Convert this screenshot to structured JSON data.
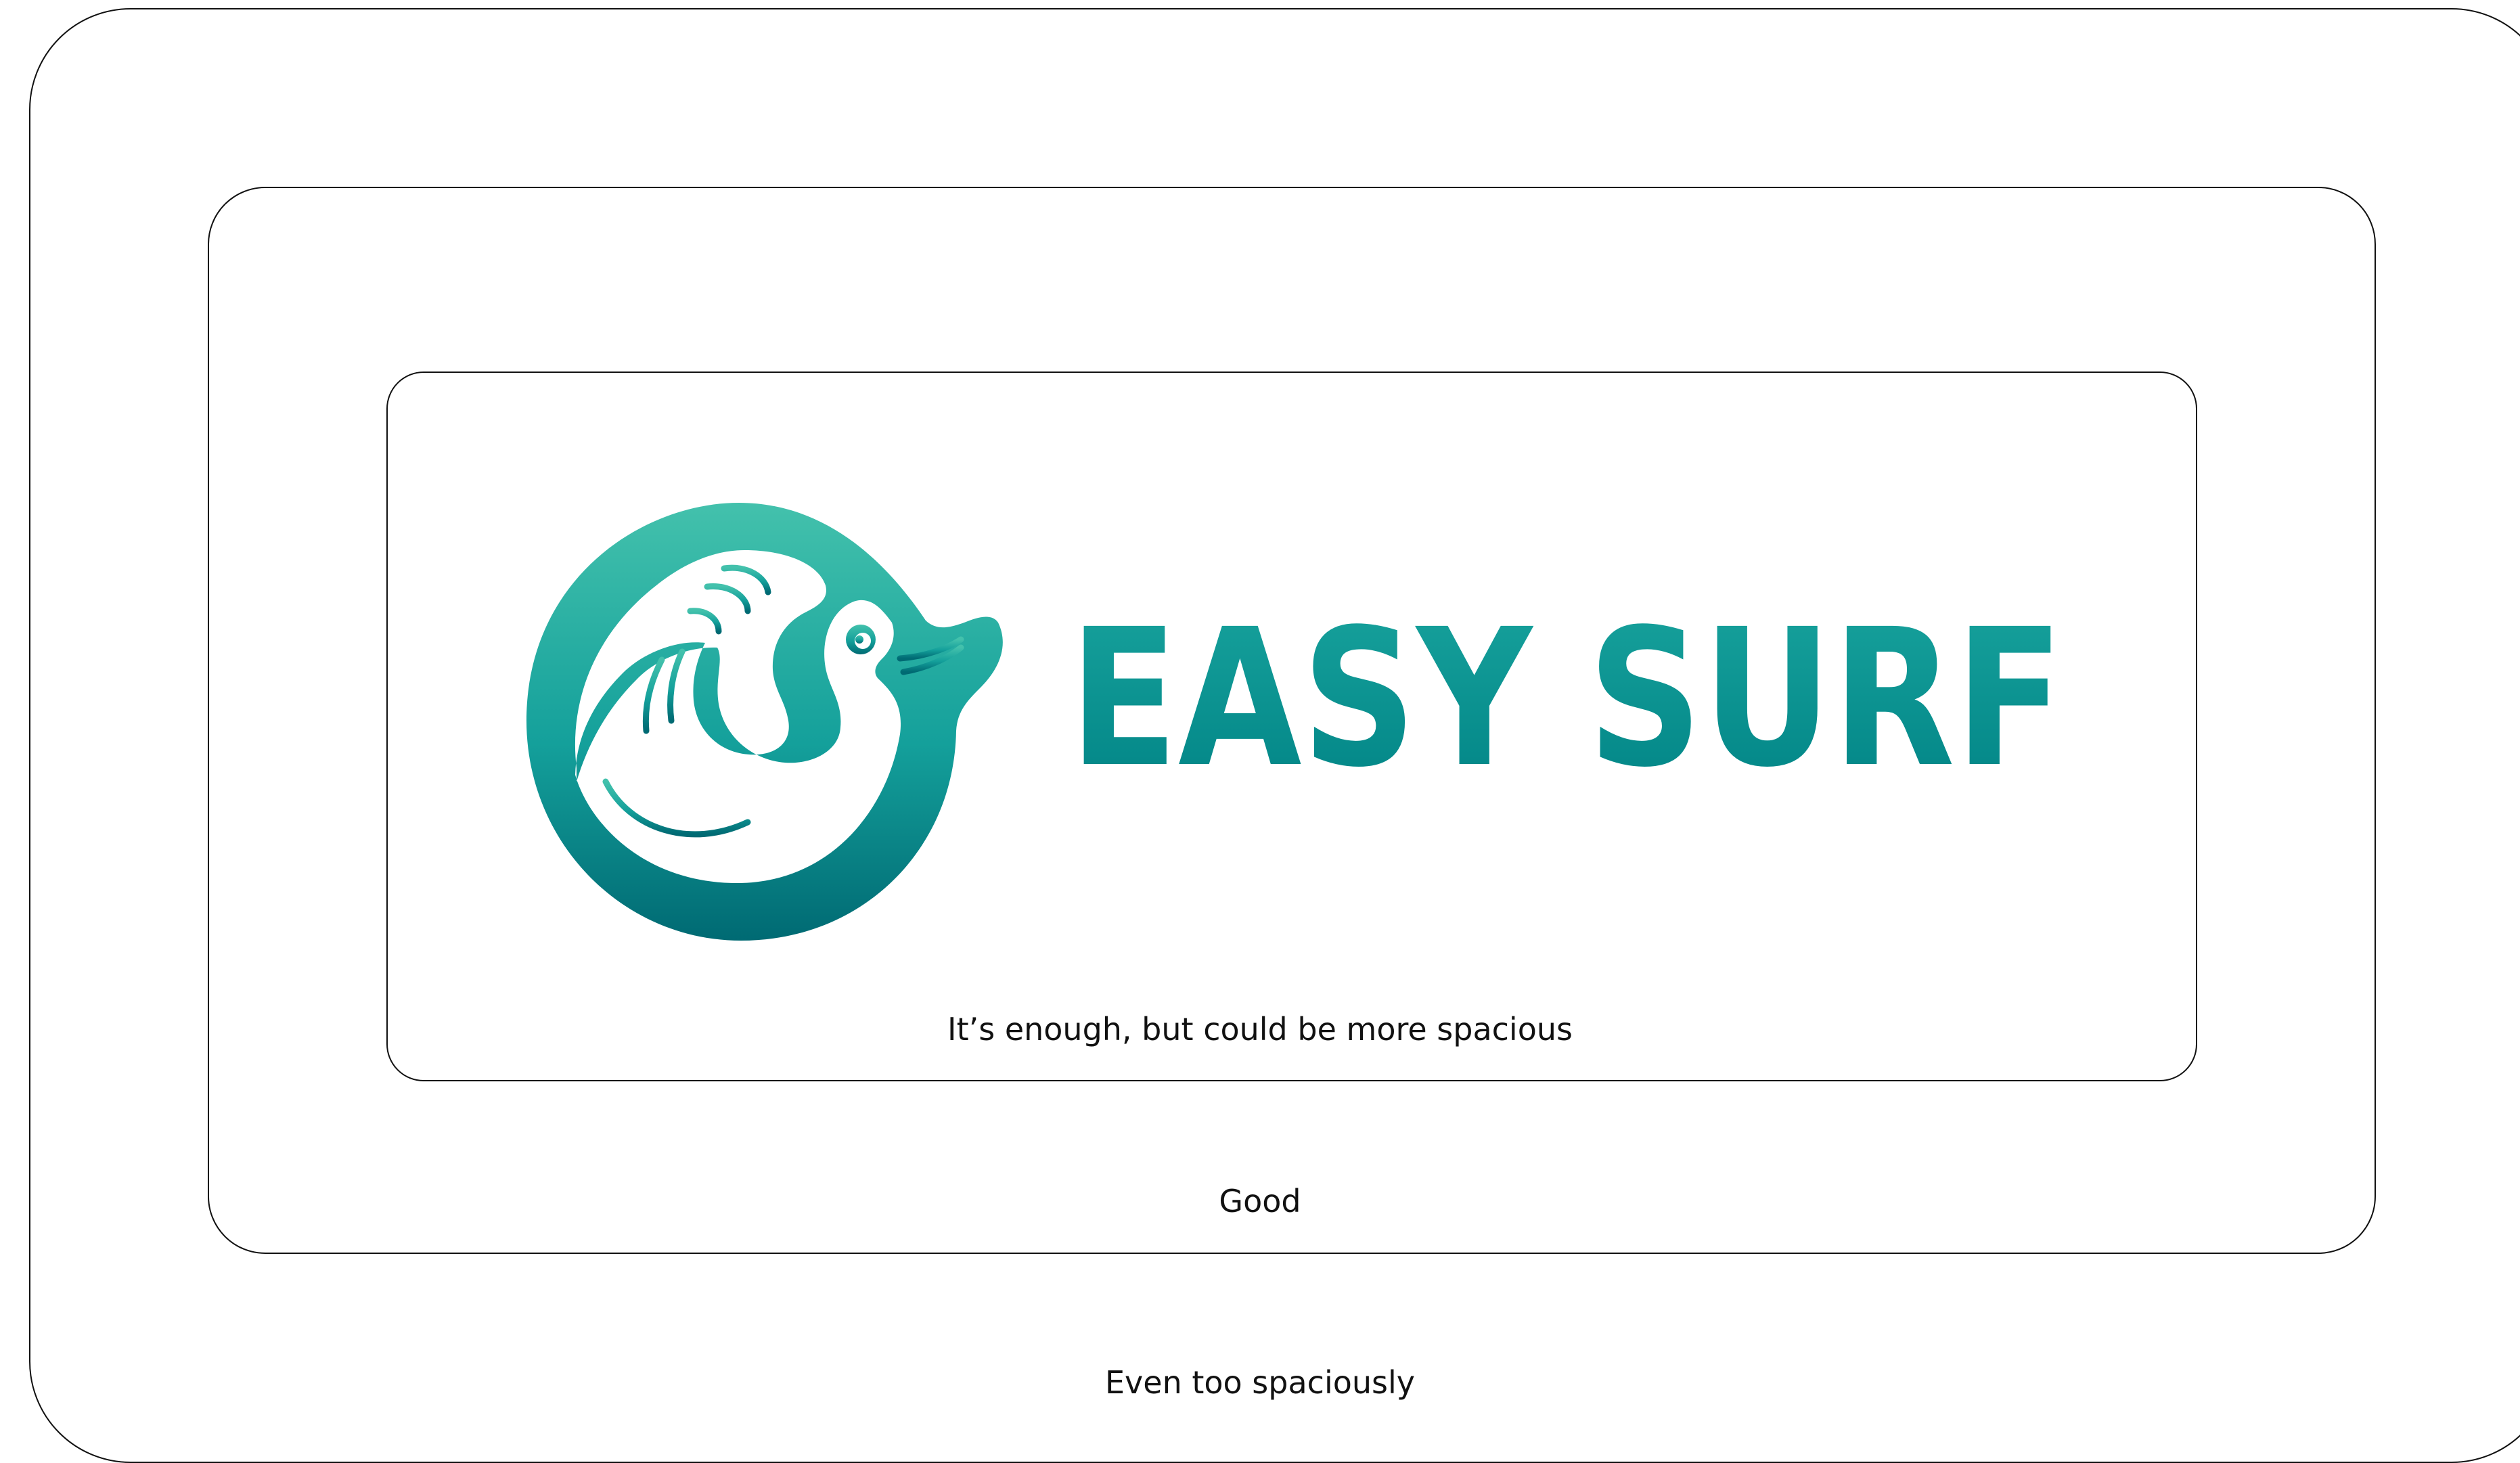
{
  "logo": {
    "wordmark": "EASY SURF",
    "mark_icon": "surf-wave-bird-icon",
    "gradient_top": "#43C1AC",
    "gradient_mid": "#14A09B",
    "gradient_bottom": "#006A73"
  },
  "frames": [
    {
      "caption": "It’s enough, but could be more spacious"
    },
    {
      "caption": "Good"
    },
    {
      "caption": "Even too spaciously"
    }
  ]
}
